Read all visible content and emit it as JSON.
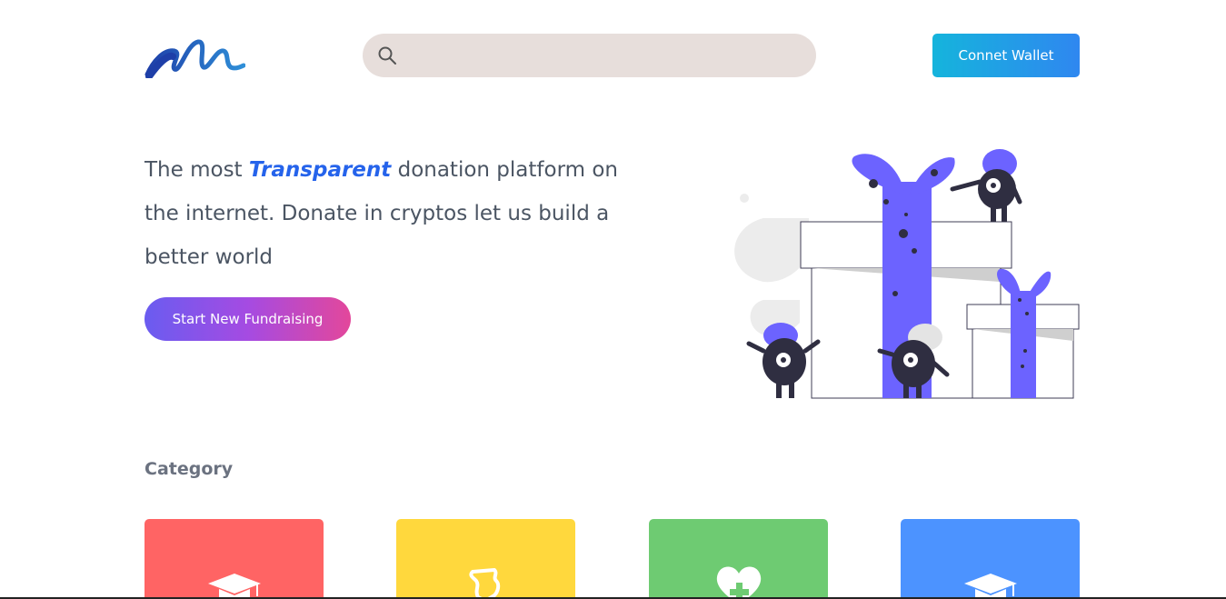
{
  "header": {
    "logo_icon": "wave-m-logo",
    "search": {
      "placeholder": "",
      "value": "",
      "icon": "search-icon"
    },
    "connect_wallet_label": "Connet Wallet"
  },
  "hero": {
    "text_before": "The most ",
    "highlight": "Transparent",
    "text_after": " donation platform on the internet. Donate in cryptos let us build a better world",
    "cta_label": "Start New Fundraising",
    "illustration": "gift-boxes-with-monsters"
  },
  "category": {
    "title": "Category",
    "cards": [
      {
        "color": "#ff6464",
        "icon": "graduation-cap-icon"
      },
      {
        "color": "#ffd83d",
        "icon": "map-shape-icon"
      },
      {
        "color": "#6ecb72",
        "icon": "heart-plus-icon"
      },
      {
        "color": "#4c93ff",
        "icon": "graduation-cap-icon"
      }
    ]
  },
  "colors": {
    "accent_blue": "#2563eb",
    "illustration_purple": "#6c63ff",
    "search_bg": "#e7dedb"
  }
}
